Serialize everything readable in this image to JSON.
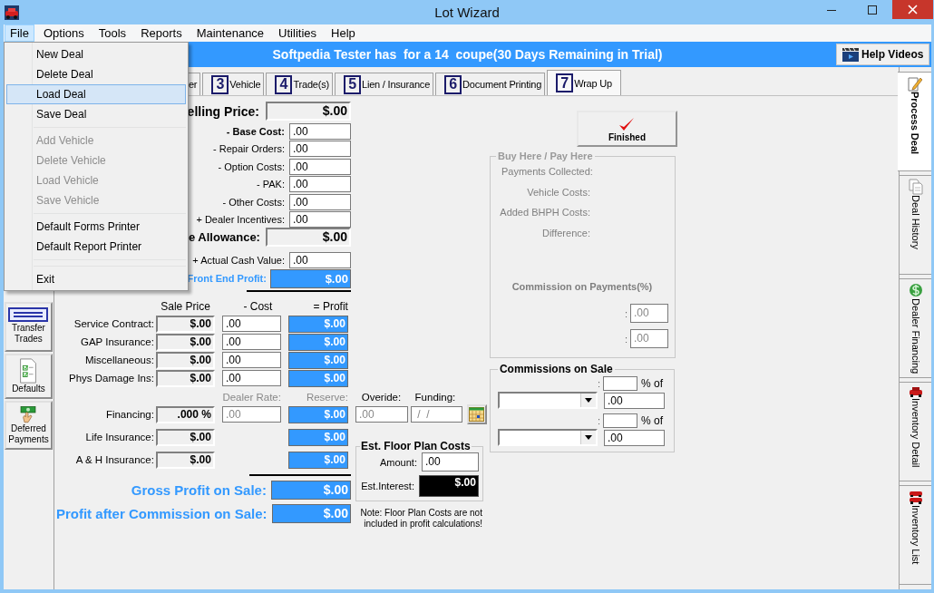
{
  "window": {
    "title": "Lot Wizard"
  },
  "menu_bar": [
    {
      "label": "File",
      "selected": true
    },
    {
      "label": "Options",
      "selected": false
    },
    {
      "label": "Tools",
      "selected": false
    },
    {
      "label": "Reports",
      "selected": false
    },
    {
      "label": "Maintenance",
      "selected": false
    },
    {
      "label": "Utilities",
      "selected": false
    },
    {
      "label": "Help",
      "selected": false
    }
  ],
  "file_menu": [
    {
      "kind": "item",
      "label": "New Deal",
      "disabled": false,
      "selected": false
    },
    {
      "kind": "item",
      "label": "Delete Deal",
      "disabled": false,
      "selected": false
    },
    {
      "kind": "item",
      "label": "Load Deal",
      "disabled": false,
      "selected": true
    },
    {
      "kind": "item",
      "label": "Save Deal",
      "disabled": false,
      "selected": false
    },
    {
      "kind": "separator"
    },
    {
      "kind": "item",
      "label": "Add Vehicle",
      "disabled": true,
      "selected": false
    },
    {
      "kind": "item",
      "label": "Delete Vehicle",
      "disabled": true,
      "selected": false
    },
    {
      "kind": "item",
      "label": "Load Vehicle",
      "disabled": true,
      "selected": false
    },
    {
      "kind": "item",
      "label": "Save Vehicle",
      "disabled": true,
      "selected": false
    },
    {
      "kind": "separator"
    },
    {
      "kind": "item",
      "label": "Default Forms Printer",
      "disabled": false,
      "selected": false
    },
    {
      "kind": "item",
      "label": "Default Report Printer",
      "disabled": false,
      "selected": false
    },
    {
      "kind": "separator"
    },
    {
      "kind": "separator"
    },
    {
      "kind": "item",
      "label": "Exit",
      "disabled": false,
      "selected": false
    }
  ],
  "banner": {
    "text": "Softpedia Tester has  for a 14  coupe(30 Days Remaining in Trial)",
    "help_button": "Help Videos"
  },
  "sidebar": [
    {
      "kind": "stamp",
      "label": "Transfer Trades"
    },
    {
      "kind": "checklist",
      "label": "Defaults"
    },
    {
      "kind": "money",
      "label": "Deferred Payments"
    }
  ],
  "tabs": [
    {
      "label": "er",
      "selected": false
    },
    {
      "number": "3",
      "label": "Vehicle",
      "selected": false
    },
    {
      "number": "4",
      "label": "Trade(s)",
      "selected": false
    },
    {
      "number": "5",
      "label": "Lien / Insurance",
      "selected": false
    },
    {
      "number": "6",
      "label": "Document Printing",
      "selected": false
    },
    {
      "number": "7",
      "label": "Wrap Up",
      "selected": true
    }
  ],
  "cost_summary": {
    "selling_price": {
      "label": "elling Price:",
      "value": "$.00"
    },
    "costs": [
      {
        "label": "- Base Cost:",
        "value": ".00",
        "bold": true
      },
      {
        "label": "- Repair Orders:",
        "value": ".00",
        "bold": false
      },
      {
        "label": "- Option Costs:",
        "value": ".00",
        "bold": false
      },
      {
        "label": "- PAK:",
        "value": ".00",
        "bold": false
      },
      {
        "label": "- Other Costs:",
        "value": ".00",
        "bold": false
      },
      {
        "label": "+ Dealer Incentives:",
        "value": ".00",
        "bold": false
      }
    ],
    "allowance": {
      "label": "e Allowance:",
      "value": "$.00"
    },
    "actual_cash_value": {
      "label": "+ Actual Cash Value:",
      "value": ".00"
    },
    "front_end_profit": {
      "label": "Front End Profit:",
      "value": "$.00"
    }
  },
  "products": {
    "columns": [
      "Sale Price",
      "- Cost",
      "= Profit"
    ],
    "rows": [
      {
        "label": "Service Contract:",
        "sale_price": "$.00",
        "cost": ".00",
        "profit": "$.00"
      },
      {
        "label": "GAP Insurance:",
        "sale_price": "$.00",
        "cost": ".00",
        "profit": "$.00"
      },
      {
        "label": "Miscellaneous:",
        "sale_price": "$.00",
        "cost": ".00",
        "profit": "$.00"
      },
      {
        "label": "Phys Damage Ins:",
        "sale_price": "$.00",
        "cost": ".00",
        "profit": "$.00"
      }
    ]
  },
  "financing": {
    "headers": [
      {
        "label": "Dealer Rate:",
        "disabled": true
      },
      {
        "label": "Reserve:",
        "disabled": true
      },
      {
        "label": "Overide:",
        "disabled": false
      },
      {
        "label": "Funding:",
        "disabled": false
      }
    ],
    "label": "Financing:",
    "rate": ".000 %",
    "dealer_rate": ".00",
    "reserve": "$.00",
    "override": ".00",
    "funding": " /  /"
  },
  "insurance": [
    {
      "label": "Life Insurance:",
      "value": "$.00",
      "profit": "$.00"
    },
    {
      "label": "A & H Insurance:",
      "value": "$.00",
      "profit": "$.00"
    }
  ],
  "totals": [
    {
      "label": "Gross Profit on Sale:",
      "value": "$.00"
    },
    {
      "label": "Profit after Commission on Sale:",
      "value": "$.00"
    }
  ],
  "floor_plan": {
    "title": "Est. Floor Plan Costs",
    "amount_label": "Amount:",
    "amount": ".00",
    "interest_label": "Est.Interest:",
    "interest": "$.00",
    "note": "Note: Floor Plan Costs are not included in profit calculations!"
  },
  "finished_button": "Finished",
  "bhph": {
    "title": "Buy Here / Pay Here",
    "fields": [
      "Payments Collected:",
      "Vehicle Costs:",
      "Added BHPH Costs:",
      "Difference:"
    ],
    "commission_title": "Commission on Payments(%)",
    "commission_values": [
      {
        "prefix": ":",
        "value": ".00"
      },
      {
        "prefix": ":",
        "value": ".00"
      }
    ]
  },
  "commissions": {
    "title": "Commissions on Sale",
    "rows": [
      {
        "prefix": ":",
        "percent_label": "% of",
        "amount": ".00"
      },
      {
        "prefix": ":",
        "percent_label": "% of",
        "amount": ".00"
      }
    ]
  },
  "right_tabs": [
    {
      "kind": "pencil",
      "label": "Process Deal",
      "selected": true
    },
    {
      "kind": "pages",
      "label": "Deal History",
      "selected": false
    },
    {
      "kind": "dollar",
      "label": "Dealer Financing",
      "selected": false
    },
    {
      "kind": "car",
      "label": "Inventory Detail",
      "selected": false
    },
    {
      "kind": "cars",
      "label": "Inventory List",
      "selected": false
    }
  ]
}
